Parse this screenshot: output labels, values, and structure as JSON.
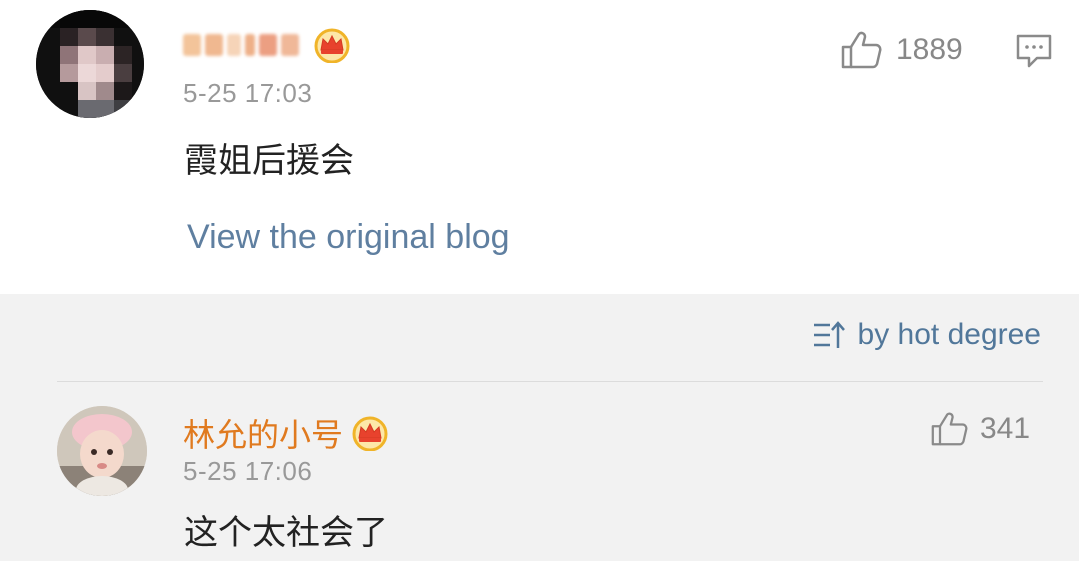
{
  "comment1": {
    "time": "5-25 17:03",
    "text": "霞姐后援会",
    "likes": "1889",
    "view_link": "View the original blog",
    "icons": [
      "crown-badge-icon",
      "thumb-up-icon",
      "comment-icon"
    ]
  },
  "sort": {
    "label": "by hot degree",
    "icon": "sort-icon"
  },
  "comment2": {
    "username": "林允的小号",
    "time": "5-25 17:06",
    "text": "这个太社会了",
    "likes": "341",
    "icons": [
      "crown-badge-icon",
      "thumb-up-icon"
    ]
  },
  "colors": {
    "link": "#5f7fa0",
    "username_orange": "#e07a1f",
    "crown_gold": "#f0b429",
    "muted": "#999999"
  }
}
